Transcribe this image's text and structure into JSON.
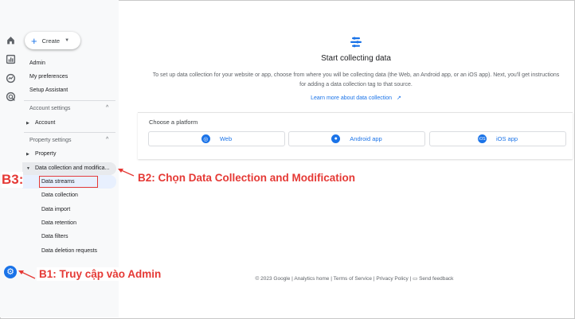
{
  "create_label": "Create",
  "nav": {
    "admin": "Admin",
    "preferences": "My preferences",
    "setup_assistant": "Setup Assistant",
    "account_settings": "Account settings",
    "account": "Account",
    "property_settings": "Property settings",
    "property": "Property",
    "data_collection": "Data collection and modifica...",
    "sub_items": [
      "Data streams",
      "Data collection",
      "Data import",
      "Data retention",
      "Data filters",
      "Data deletion requests"
    ]
  },
  "main": {
    "title": "Start collecting data",
    "description": "To set up data collection for your website or app, choose from where you will be collecting data (the Web, an Android app, or an iOS app). Next, you'll get instructions for adding a data collection tag to that source.",
    "learn_more": "Learn more about data collection",
    "choose_platform": "Choose a platform",
    "platforms": [
      "Web",
      "Android app",
      "iOS app"
    ]
  },
  "footer": {
    "copyright": "© 2023 Google",
    "links": [
      "Analytics home",
      "Terms of Service",
      "Privacy Policy"
    ],
    "feedback": "Send feedback"
  },
  "annotations": {
    "b1": "B1: Truy cập vào Admin",
    "b2": "B2: Chọn Data Collection and Modification",
    "b3": "B3:"
  },
  "colors": {
    "accent": "#1a73e8",
    "annotation": "#e53935"
  },
  "icons": [
    "home-icon",
    "reports-icon",
    "explore-icon",
    "advertising-icon",
    "admin-gear-icon",
    "start-collecting-icon",
    "globe-icon",
    "android-icon",
    "ios-icon",
    "external-link-icon",
    "feedback-icon"
  ]
}
